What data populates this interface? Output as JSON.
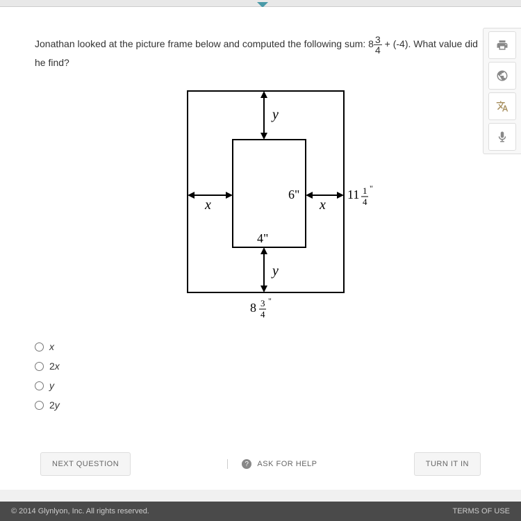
{
  "question": {
    "prefix": "Jonathan looked at the picture frame below and computed the following sum: 8",
    "frac_num": "3",
    "frac_den": "4",
    "suffix": " + (-4). What value did he find?"
  },
  "diagram": {
    "inner_width": "4\"",
    "inner_height": "6\"",
    "outer_width": "11 1/4\"",
    "outer_height": "8 3/4\"",
    "x_label": "x",
    "y_label": "y",
    "outer_width_whole": "11",
    "outer_width_num": "1",
    "outer_width_den": "4",
    "outer_height_whole": "8",
    "outer_height_num": "3",
    "outer_height_den": "4"
  },
  "options": [
    {
      "prefix": "",
      "var": "x"
    },
    {
      "prefix": "2",
      "var": "x"
    },
    {
      "prefix": "",
      "var": "y"
    },
    {
      "prefix": "2",
      "var": "y"
    }
  ],
  "buttons": {
    "next": "NEXT QUESTION",
    "ask": "ASK FOR HELP",
    "turn_in": "TURN IT IN"
  },
  "sidebar": {
    "print": "print-icon",
    "globe": "globe-icon",
    "translate": "translate-icon",
    "mic": "mic-icon"
  },
  "footer": {
    "copyright": "© 2014 Glynlyon, Inc. All rights reserved.",
    "terms": "TERMS OF USE"
  }
}
